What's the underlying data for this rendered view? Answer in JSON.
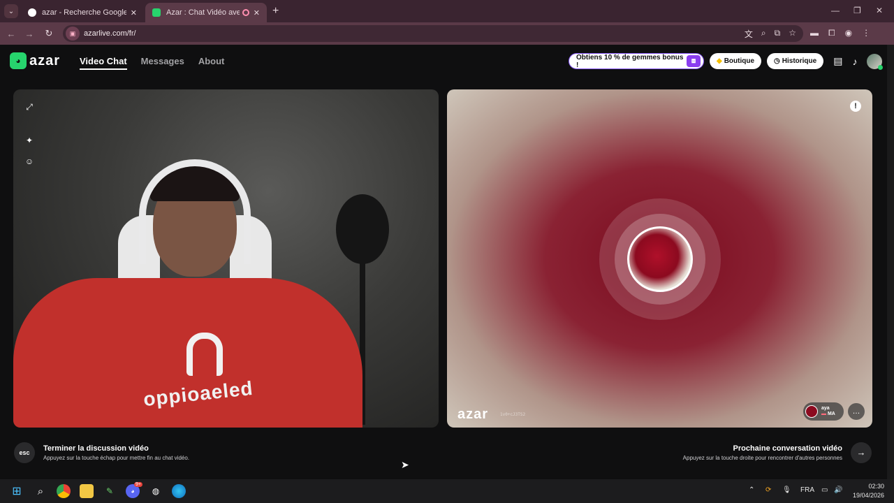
{
  "browser": {
    "tabs": [
      {
        "title": "azar - Recherche Google",
        "favicon": "google-icon"
      },
      {
        "title": "Azar : Chat Vidéo avec de n",
        "favicon": "azar-icon",
        "active": true
      }
    ],
    "url": "azarlive.com/fr/"
  },
  "header": {
    "logo": "azar",
    "nav": [
      "Video Chat",
      "Messages",
      "About"
    ],
    "promo": "Obtiens 10 % de gemmes bonus !",
    "shop": "Boutique",
    "history": "Historique"
  },
  "remote": {
    "logo": "azar",
    "session_id": "1v0+cJ3TS2",
    "user_name": "aya",
    "user_country": "MA"
  },
  "shirt_text": "oppioaeled",
  "actions": {
    "esc_key": "esc",
    "end_title": "Terminer la discussion vidéo",
    "end_sub": "Appuyez sur la touche échap pour mettre fin au chat vidéo.",
    "next_title": "Prochaine conversation vidéo",
    "next_sub": "Appuyez sur la touche droite pour rencontrer d'autres personnes"
  },
  "taskbar": {
    "lang": "FRA",
    "time": "02:30",
    "date": "19/04/2026",
    "discord_badge": "9+"
  },
  "colors": {
    "accent_green": "#27d46d",
    "chrome_tab_bg": "#3a2430",
    "chrome_toolbar": "#5b3a48",
    "promo_purple": "#8a3df0"
  }
}
